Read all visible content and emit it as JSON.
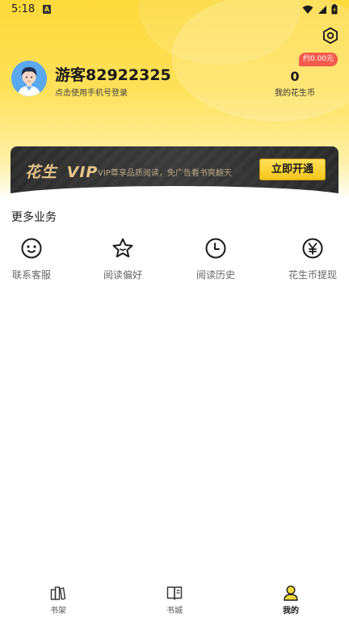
{
  "status_bar": {
    "time": "5:18",
    "notification_badge": "A",
    "icons": [
      "wifi-icon",
      "signal-icon",
      "battery-icon"
    ]
  },
  "profile": {
    "username": "游客82922325",
    "login_hint": "点击使用手机号登录",
    "coin_badge": "约0.00元",
    "coin_count": "0",
    "coin_label": "我的花生币"
  },
  "vip": {
    "logo_prefix": "花生",
    "logo_suffix": "VIP",
    "description": "VIP尊享品质阅读，免广告看书爽翻天",
    "button_label": "立即开通"
  },
  "services": {
    "title": "更多业务",
    "items": [
      {
        "label": "联系客服",
        "icon": "customer-service-icon"
      },
      {
        "label": "阅读偏好",
        "icon": "star-icon"
      },
      {
        "label": "阅读历史",
        "icon": "clock-icon"
      },
      {
        "label": "花生币提现",
        "icon": "yen-icon"
      }
    ]
  },
  "bottom_nav": {
    "items": [
      {
        "label": "书架",
        "icon": "bookshelf-icon",
        "active": false
      },
      {
        "label": "书城",
        "icon": "book-icon",
        "active": false
      },
      {
        "label": "我的",
        "icon": "profile-icon",
        "active": true
      }
    ]
  },
  "colors": {
    "accent_yellow": "#fdd93a",
    "badge_red": "#f25a4c",
    "vip_gold": "#e6c48a",
    "vip_dark": "#2c2c2c"
  }
}
